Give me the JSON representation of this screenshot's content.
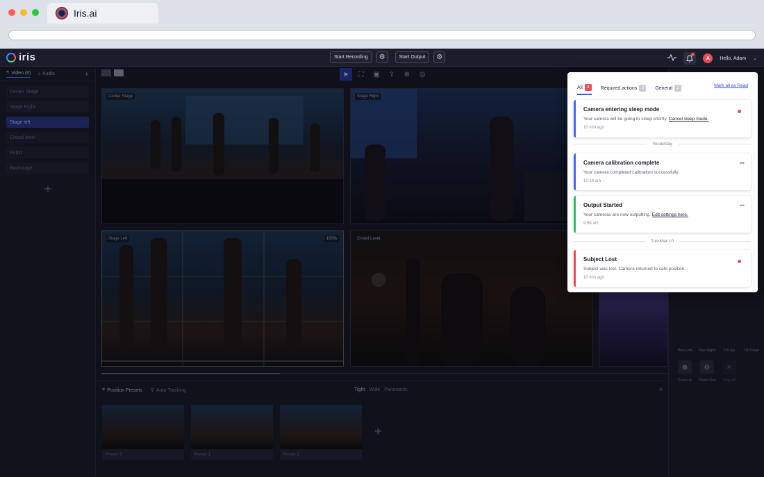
{
  "browser": {
    "tab_title": "Iris.ai",
    "dot_colors": [
      "#ff5f57",
      "#febc2e",
      "#28c840"
    ]
  },
  "topbar": {
    "brand": "iris",
    "start_recording": "Start Recording",
    "start_output": "Start Output",
    "user_greeting": "Hello, Adam",
    "avatar_initial": "A",
    "icons": [
      "activity-icon",
      "bell-icon",
      "gear-icon",
      "chevron-down-icon"
    ]
  },
  "sidebar": {
    "tabs": [
      {
        "label": "Video (6)",
        "icon": "location-pin-icon",
        "active": true
      },
      {
        "label": "Audio",
        "icon": "microphone-icon",
        "active": false
      }
    ],
    "items": [
      {
        "label": "Center Stage",
        "active": false
      },
      {
        "label": "Stage Right",
        "active": false
      },
      {
        "label": "Stage left",
        "active": true
      },
      {
        "label": "Crowd level",
        "active": false
      },
      {
        "label": "Pulpit",
        "active": false
      },
      {
        "label": "Backstage",
        "active": false
      }
    ]
  },
  "toolbar": {
    "view_icons": [
      "single-view-icon",
      "grid-view-icon"
    ],
    "camera_tools": [
      "cursor-icon",
      "focus-frame-icon",
      "crop-frame-icon",
      "upload-icon",
      "zoom-icon",
      "target-icon"
    ]
  },
  "cameras": [
    {
      "label": "Center Stage"
    },
    {
      "label": "Stage Right"
    },
    {
      "label": "Stage Left",
      "zoom": "100%"
    },
    {
      "label": "Crowd Level"
    }
  ],
  "presets": {
    "tabs": [
      {
        "label": "Position Presets",
        "icon": "pin-icon",
        "active": true
      },
      {
        "label": "Auto Tracking",
        "icon": "tracking-icon",
        "active": false
      }
    ],
    "filters": [
      {
        "label": "Tight",
        "active": true
      },
      {
        "label": "Wide",
        "active": false
      },
      {
        "label": "Panoramic",
        "active": false
      }
    ],
    "cards": [
      {
        "label": "Preset 3"
      },
      {
        "label": "Preset 1"
      },
      {
        "label": "Preset 2"
      }
    ]
  },
  "controls": {
    "pan_labels": [
      "Pan Left",
      "Pan Right",
      "Tilt Up",
      "Tilt Down"
    ],
    "zoom_buttons": [
      {
        "label": "Zoom In",
        "icon": "zoom-in-icon"
      },
      {
        "label": "Zoom Out",
        "icon": "zoom-out-icon"
      },
      {
        "label": "Stop All",
        "icon": "close-icon"
      }
    ]
  },
  "notifications": {
    "tabs": [
      {
        "label": "All",
        "count": "4",
        "active": true
      },
      {
        "label": "Required actions",
        "count": "3",
        "active": false
      },
      {
        "label": "General",
        "count": "2",
        "active": false
      }
    ],
    "mark_all": "Mark all as Read",
    "items": [
      {
        "title": "Camera entering sleep mode",
        "body": "Your camera will be going to sleep shortly.",
        "link": "Cancel sleep mode.",
        "time": "10 min ago",
        "accent": "#4a67f5",
        "unread": true
      },
      {
        "title": "Camera calibration complete",
        "body": "Your camera completed calibration successfully.",
        "link": "",
        "time": "10:18 am",
        "accent": "#4a67f5",
        "unread": false
      },
      {
        "title": "Output Started",
        "body": "Your cameras are now outputting.",
        "link": "Edit settings here.",
        "time": "9:58 am",
        "accent": "#2fc06a",
        "unread": false
      },
      {
        "title": "Subject Lost",
        "body": "Subject was lost. Camera returned to safe position.",
        "link": "",
        "time": "10 min ago",
        "accent": "#ea4d5b",
        "unread": true
      }
    ],
    "separators": [
      "Yesterday",
      "Tue Mar 10"
    ]
  }
}
